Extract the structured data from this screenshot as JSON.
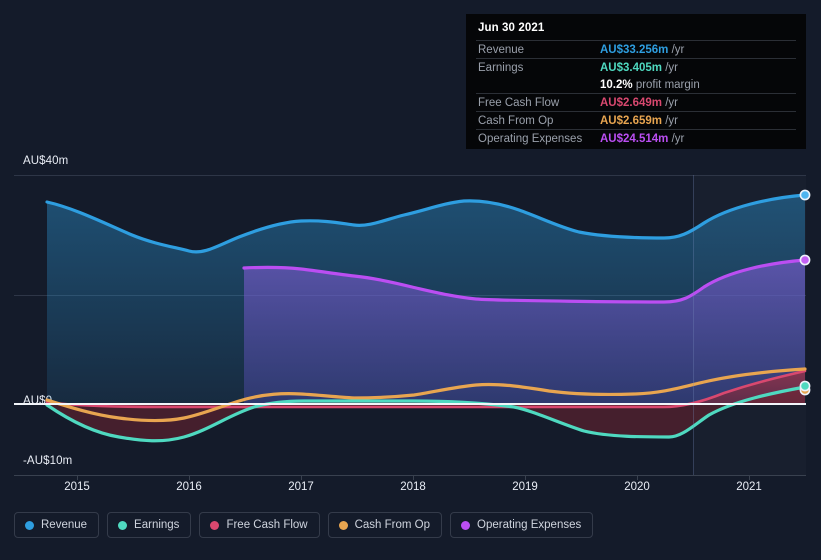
{
  "background": "#141b2a",
  "colors": {
    "revenue": "#2e9ee0",
    "earnings": "#4fd9c0",
    "free_cash_flow": "#d9486f",
    "cash_from_op": "#e8a550",
    "operating_expenses": "#bb4ef2",
    "zero_line": "#f2f5fa",
    "grid": "#2e3647"
  },
  "tooltip": {
    "date": "Jun 30 2021",
    "rows": [
      {
        "label": "Revenue",
        "amount": "AU$33.256m",
        "unit": "/yr",
        "color": "#2e9ee0"
      },
      {
        "label": "Earnings",
        "amount": "AU$3.405m",
        "unit": "/yr",
        "color": "#4fd9c0"
      },
      {
        "label": "",
        "amount": "10.2%",
        "unit": "profit margin",
        "color": "#ffffff",
        "margin_row": true
      },
      {
        "label": "Free Cash Flow",
        "amount": "AU$2.649m",
        "unit": "/yr",
        "color": "#d9486f"
      },
      {
        "label": "Cash From Op",
        "amount": "AU$2.659m",
        "unit": "/yr",
        "color": "#e8a550"
      },
      {
        "label": "Operating Expenses",
        "amount": "AU$24.514m",
        "unit": "/yr",
        "color": "#bb4ef2"
      }
    ]
  },
  "legend": {
    "items": [
      {
        "label": "Revenue",
        "color": "#2e9ee0"
      },
      {
        "label": "Earnings",
        "color": "#4fd9c0"
      },
      {
        "label": "Free Cash Flow",
        "color": "#d9486f"
      },
      {
        "label": "Cash From Op",
        "color": "#e8a550"
      },
      {
        "label": "Operating Expenses",
        "color": "#bb4ef2"
      }
    ]
  },
  "chart_data": {
    "type": "area",
    "title": "",
    "xlabel": "",
    "ylabel": "AU$",
    "ylim": [
      -10,
      40
    ],
    "yticks": [
      40,
      20,
      0,
      -10
    ],
    "ytick_labels": [
      "AU$40m",
      "",
      "AU$0",
      "-AU$10m"
    ],
    "grid": true,
    "legend_position": "bottom",
    "x": [
      "2014-06-30",
      "2014-12-31",
      "2015-06-30",
      "2015-12-31",
      "2016-06-30",
      "2016-12-31",
      "2017-06-30",
      "2017-12-31",
      "2018-06-30",
      "2018-12-31",
      "2019-06-30",
      "2019-12-31",
      "2020-06-30",
      "2020-12-31",
      "2021-06-30"
    ],
    "xtick_labels": [
      "2015",
      "2016",
      "2017",
      "2018",
      "2019",
      "2020",
      "2021"
    ],
    "series": [
      {
        "name": "Revenue",
        "color": "#2e9ee0",
        "values": [
          37.2,
          33.6,
          30.7,
          29.5,
          28.0,
          29.8,
          32.0,
          31.2,
          30.8,
          31.7,
          33.3,
          31.8,
          30.6,
          32.0,
          33.256
        ]
      },
      {
        "name": "Operating Expenses",
        "color": "#bb4ef2",
        "values": [
          null,
          null,
          null,
          null,
          null,
          26.3,
          26.0,
          25.8,
          26.3,
          25.6,
          24.6,
          23.7,
          23.6,
          24.1,
          24.514
        ]
      },
      {
        "name": "Earnings",
        "color": "#4fd9c0",
        "values": [
          -0.3,
          -4.0,
          -6.5,
          -7.9,
          -6.6,
          -2.6,
          -1.0,
          -1.1,
          -0.9,
          -0.6,
          -1.9,
          -4.0,
          -4.1,
          1.4,
          3.405
        ]
      },
      {
        "name": "Cash From Op",
        "color": "#e8a550",
        "values": [
          0.2,
          -1.1,
          -2.6,
          -2.4,
          -1.8,
          0.6,
          0.3,
          0.1,
          0.6,
          0.7,
          1.7,
          1.3,
          0.9,
          1.9,
          2.659
        ]
      },
      {
        "name": "Free Cash Flow",
        "color": "#d9486f",
        "values": [
          0.1,
          -0.2,
          -0.2,
          -0.2,
          -0.2,
          -0.2,
          -0.2,
          -0.2,
          -0.2,
          -0.2,
          -0.2,
          -0.2,
          -0.2,
          1.0,
          2.649
        ]
      }
    ],
    "end_markers": [
      {
        "series": "Revenue",
        "value": 33.256
      },
      {
        "series": "Operating Expenses",
        "value": 24.514
      },
      {
        "series": "Earnings",
        "value": 3.405
      },
      {
        "series": "Cash From Op",
        "value": 2.659
      }
    ]
  }
}
